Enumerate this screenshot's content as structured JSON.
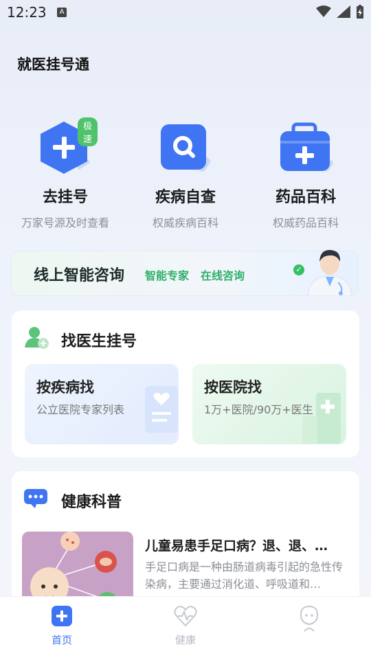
{
  "status_bar": {
    "time": "12:23",
    "notification_icon_letter": "A"
  },
  "app": {
    "title": "就医挂号通"
  },
  "quick_actions": [
    {
      "label": "去挂号",
      "sub": "万家号源及时查看",
      "badge": "极速",
      "icon": "plus-hexagon-icon"
    },
    {
      "label": "疾病自查",
      "sub": "权威疾病百科",
      "icon": "search-icon"
    },
    {
      "label": "药品百科",
      "sub": "权威药品百科",
      "icon": "medicine-kit-icon"
    }
  ],
  "consult_banner": {
    "title": "线上智能咨询",
    "tag1": "智能专家",
    "tag2": "在线咨询"
  },
  "find_doctor": {
    "title": "找医生挂号",
    "cards": [
      {
        "title": "按疾病找",
        "desc": "公立医院专家列表"
      },
      {
        "title": "按医院找",
        "desc": "1万+医院/90万+医生"
      }
    ]
  },
  "health_science": {
    "title": "健康科普",
    "article": {
      "title": "儿童易患手足口病？退、退、…",
      "desc": "手足口病是一种由肠道病毒引起的急性传染病，主要通过消化道、呼吸道和…"
    }
  },
  "tabbar": {
    "tabs": [
      {
        "label": "首页",
        "active": true
      },
      {
        "label": "健康",
        "active": false
      },
      {
        "label": "",
        "active": false
      }
    ]
  },
  "colors": {
    "primary": "#3f74f2",
    "accent_green": "#2fae6a",
    "muted": "#8a8f99"
  }
}
